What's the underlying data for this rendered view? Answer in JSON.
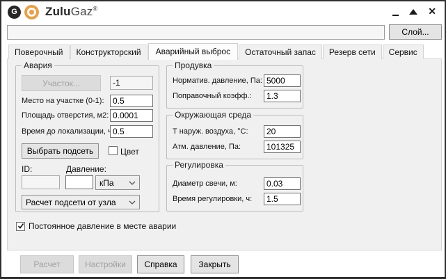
{
  "titlebar": {
    "logo_letter": "G",
    "brand_bold": "Zulu",
    "brand_light": "Gaz",
    "brand_mark": "®",
    "close_glyph": "✕"
  },
  "toolbar": {
    "layer_value": "",
    "layer_button_label": "Слой..."
  },
  "tabs": {
    "active_index": 2,
    "items": [
      {
        "label": "Поверочный"
      },
      {
        "label": "Конструкторский"
      },
      {
        "label": "Аварийный выброс"
      },
      {
        "label": "Остаточный запас"
      },
      {
        "label": "Резерв сети"
      },
      {
        "label": "Сервис"
      }
    ]
  },
  "accident": {
    "title": "Авария",
    "section_button_label": "Участок...",
    "section_id_value": "-1",
    "fields": [
      {
        "label": "Место на участке (0-1):",
        "value": "0.5"
      },
      {
        "label": "Площадь отверстия, м2:",
        "value": "0.0001"
      },
      {
        "label": "Время до локализации, ч:",
        "value": "0.5"
      }
    ],
    "select_subnet_label": "Выбрать подсеть",
    "color_checkbox_label": "Цвет",
    "color_checked": false,
    "id_label": "ID:",
    "pressure_label": "Давление:",
    "id_value": "",
    "pressure_value": "",
    "pressure_unit": "кПа",
    "calc_mode": "Расчет подсети от узла"
  },
  "purge": {
    "title": "Продувка",
    "fields": [
      {
        "label": "Норматив. давление, Па:",
        "value": "5000"
      },
      {
        "label": "Поправочный коэфф.:",
        "value": "1.3"
      }
    ]
  },
  "environment": {
    "title": "Окружающая среда",
    "fields": [
      {
        "label": "Т наруж. воздуха, °С:",
        "value": "20"
      },
      {
        "label": "Атм. давление, Па:",
        "value": "101325"
      }
    ]
  },
  "regulation": {
    "title": "Регулировка",
    "fields": [
      {
        "label": "Диаметр свечи, м:",
        "value": "0.03"
      },
      {
        "label": "Время регулировки, ч:",
        "value": "1.5"
      }
    ]
  },
  "constant_pressure": {
    "label": "Постоянное давление в месте аварии",
    "checked": true
  },
  "footer": {
    "calc_label": "Расчет",
    "settings_label": "Настройки",
    "help_label": "Справка",
    "close_label": "Закрыть"
  },
  "colors": {
    "brand_orange": "#e2a14e",
    "logo_dark": "#262626",
    "panel_bg": "#f0f0f0",
    "window_border": "#2f2f2f"
  }
}
